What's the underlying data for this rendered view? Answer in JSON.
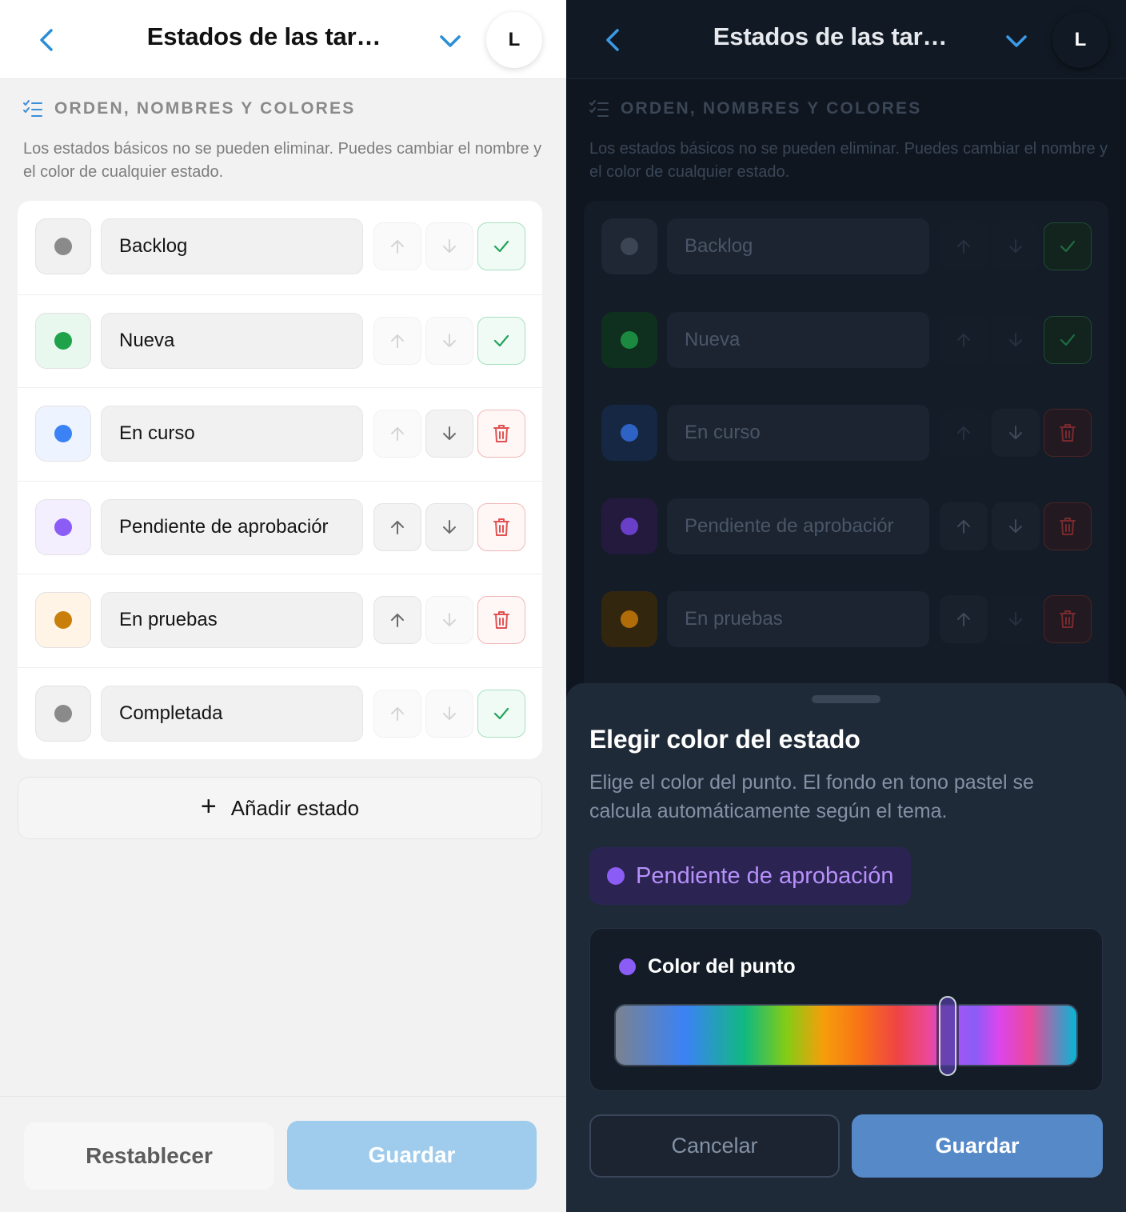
{
  "header": {
    "title": "Estados de las tar…",
    "avatar": "L",
    "icons": [
      "chevron-left-icon",
      "chevron-down-icon"
    ]
  },
  "section": {
    "title": "ORDEN, NOMBRES Y COLORES",
    "icon": "checklist-icon",
    "description": "Los estados básicos no se pueden eliminar. Puedes cambiar el nombre y el color de cualquier estado."
  },
  "states": [
    {
      "name": "Backlog",
      "dot_light": "#8a8a8a",
      "bg_light": "#f1f1f1",
      "dot_dark": "#3b4554",
      "bg_dark": "#1e2733",
      "can_up": false,
      "can_down": false,
      "action": "check"
    },
    {
      "name": "Nueva",
      "dot_light": "#1fa24a",
      "bg_light": "#e9f8ee",
      "dot_dark": "#1b8a40",
      "bg_dark": "#10301f",
      "can_up": false,
      "can_down": false,
      "action": "check"
    },
    {
      "name": "En curso",
      "dot_light": "#3b82f6",
      "bg_light": "#eef4ff",
      "dot_dark": "#2e62c4",
      "bg_dark": "#152743",
      "can_up": false,
      "can_down": true,
      "action": "delete"
    },
    {
      "name": "Pendiente de aprobaciór",
      "dot_light": "#8b5cf6",
      "bg_light": "#f4efff",
      "dot_dark": "#6a3fc8",
      "bg_dark": "#231a3d",
      "can_up": true,
      "can_down": true,
      "action": "delete"
    },
    {
      "name": "En pruebas",
      "dot_light": "#c97f0a",
      "bg_light": "#fff4e6",
      "dot_dark": "#b06c09",
      "bg_dark": "#33260f",
      "can_up": true,
      "can_down": false,
      "action": "delete"
    },
    {
      "name": "Completada",
      "dot_light": "#8a8a8a",
      "bg_light": "#f1f1f1",
      "dot_dark": "#3b4554",
      "bg_dark": "#1e2733",
      "can_up": false,
      "can_down": false,
      "action": "check"
    }
  ],
  "add_state_label": "Añadir estado",
  "footer": {
    "reset_label": "Restablecer",
    "save_label": "Guardar"
  },
  "sheet": {
    "title": "Elegir color del estado",
    "description": "Elige el color del punto. El fondo en tono pastel se calcula automáticamente según el tema.",
    "preview_label": "Pendiente de aprobación",
    "picker_label": "Color del punto",
    "selected_color": "#8b5cf6",
    "hue_position": 0.72,
    "cancel_label": "Cancelar",
    "save_label": "Guardar"
  },
  "colors": {
    "accent": "#3b82f6",
    "success": "#22a35a",
    "danger": "#e05252"
  }
}
